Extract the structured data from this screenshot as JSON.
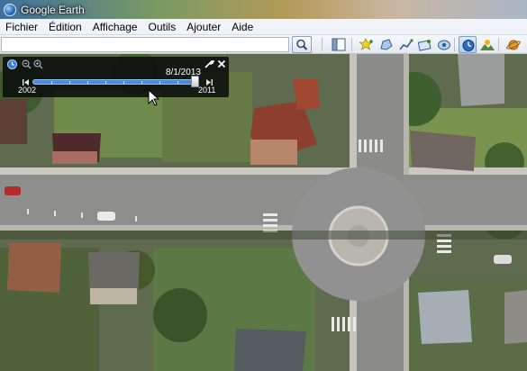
{
  "window": {
    "title": "Google Earth"
  },
  "menu": {
    "items": [
      "Fichier",
      "Édition",
      "Affichage",
      "Outils",
      "Ajouter",
      "Aide"
    ]
  },
  "search": {
    "value": "",
    "placeholder": ""
  },
  "toolbar": {
    "buttons": [
      "sidebar-toggle-icon",
      "placemark-icon",
      "polygon-icon",
      "path-icon",
      "image-overlay-icon",
      "record-tour-icon",
      "historical-imagery-icon",
      "sun-icon",
      "planet-icon"
    ]
  },
  "time_slider": {
    "current_date": "8/1/2013",
    "range_start": "2002",
    "range_end": "2011",
    "position": 0.98
  },
  "colors": {
    "accent": "#4d8ad6",
    "panel": "#0a0c0e",
    "titlebar": "#3f6f9e"
  }
}
